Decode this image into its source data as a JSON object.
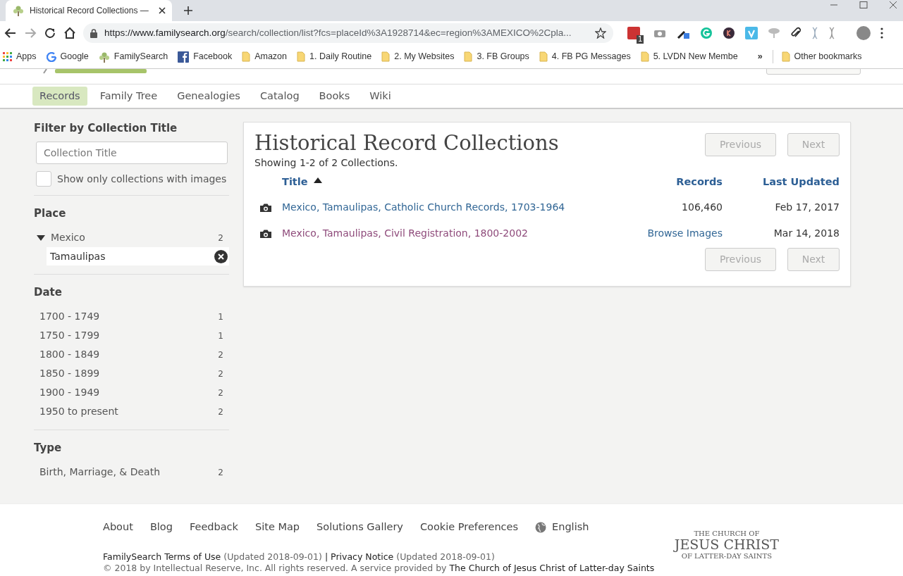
{
  "browser": {
    "tab_title": "Historical Record Collections —",
    "url_host": "https://www.familysearch.org",
    "url_path": "/search/collection/list?fcs=placeId%3A1928714&ec=region%3AMEXICO%2Cpla...",
    "extension_badge": "1",
    "bookmarks": [
      {
        "label": "Apps",
        "kind": "apps"
      },
      {
        "label": "Google",
        "kind": "google"
      },
      {
        "label": "FamilySearch",
        "kind": "tree"
      },
      {
        "label": "Facebook",
        "kind": "facebook"
      },
      {
        "label": "Amazon",
        "kind": "folder"
      },
      {
        "label": "1. Daily Routine",
        "kind": "folder"
      },
      {
        "label": "2. My Websites",
        "kind": "folder"
      },
      {
        "label": "3. FB Groups",
        "kind": "folder"
      },
      {
        "label": "4. FB PG Messages",
        "kind": "folder"
      },
      {
        "label": "5. LVDN New Membe",
        "kind": "folder"
      }
    ],
    "overflow": "»",
    "other_bookmarks": "Other bookmarks"
  },
  "site_nav": [
    {
      "label": "Records",
      "selected": true
    },
    {
      "label": "Family Tree",
      "selected": false
    },
    {
      "label": "Genealogies",
      "selected": false
    },
    {
      "label": "Catalog",
      "selected": false
    },
    {
      "label": "Books",
      "selected": false
    },
    {
      "label": "Wiki",
      "selected": false
    }
  ],
  "sidebar": {
    "filter_heading": "Filter by Collection Title",
    "filter_placeholder": "Collection Title",
    "images_only": {
      "label": "Show only collections with images",
      "checked": false
    },
    "place": {
      "heading": "Place",
      "items": [
        {
          "label": "Mexico",
          "count": "2",
          "expanded": true,
          "children": [
            {
              "label": "Tamaulipas",
              "removable": true
            }
          ]
        }
      ]
    },
    "date": {
      "heading": "Date",
      "items": [
        {
          "label": "1700 - 1749",
          "count": "1"
        },
        {
          "label": "1750 - 1799",
          "count": "1"
        },
        {
          "label": "1800 - 1849",
          "count": "2"
        },
        {
          "label": "1850 - 1899",
          "count": "2"
        },
        {
          "label": "1900 - 1949",
          "count": "2"
        },
        {
          "label": "1950 to present",
          "count": "2"
        }
      ]
    },
    "type": {
      "heading": "Type",
      "items": [
        {
          "label": "Birth, Marriage, & Death",
          "count": "2"
        }
      ]
    }
  },
  "results": {
    "title": "Historical Record Collections",
    "summary": "Showing 1-2 of 2 Collections.",
    "pager_top": [
      {
        "label": "Previous",
        "disabled": true
      },
      {
        "label": "Next",
        "disabled": true
      }
    ],
    "columns": [
      {
        "label": "Title",
        "sorted_ascending": true
      },
      {
        "label": "Records",
        "sorted_ascending": false
      },
      {
        "label": "Last Updated",
        "sorted_ascending": false
      }
    ],
    "rows": [
      {
        "title": "Mexico, Tamaulipas, Catholic Church Records, 1703-1964",
        "visited": false,
        "records": "106,460",
        "records_is_link": false,
        "updated": "Feb 17, 2017"
      },
      {
        "title": "Mexico, Tamaulipas, Civil Registration, 1800-2002",
        "visited": true,
        "records": "Browse Images",
        "records_is_link": true,
        "updated": "Mar 14, 2018"
      }
    ],
    "pager_bottom": [
      {
        "label": "Previous",
        "disabled": true
      },
      {
        "label": "Next",
        "disabled": true
      }
    ]
  },
  "footer": {
    "links": [
      "About",
      "Blog",
      "Feedback",
      "Site Map",
      "Solutions Gallery",
      "Cookie Preferences"
    ],
    "language": "English",
    "legal": [
      {
        "text": "FamilySearch Terms of Use",
        "kind": "link"
      },
      {
        "text": "(Updated 2018-09-01)",
        "kind": "note"
      },
      {
        "text": "|",
        "kind": "sep"
      },
      {
        "text": "Privacy Notice",
        "kind": "link"
      },
      {
        "text": "(Updated 2018-09-01)",
        "kind": "note"
      }
    ],
    "copyright": "© 2018 by Intellectual Reserve, Inc. All rights reserved. A service provided by",
    "copyright_link": "The Church of Jesus Christ of Latter-day Saints",
    "logo": [
      "THE CHURCH OF",
      "JESUS CHRIST",
      "OF LATTER-DAY SAINTS"
    ]
  }
}
